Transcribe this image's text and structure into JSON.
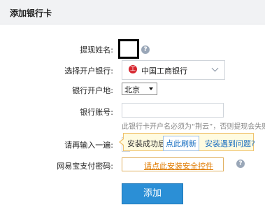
{
  "header": {
    "title": "添加银行卡"
  },
  "form": {
    "name_label": "提现姓名:",
    "name_help_icon": "question-circle-icon",
    "bank_label": "选择开户银行:",
    "bank_selected": "中国工商银行",
    "bank_logo_icon": "icbc-logo-icon",
    "city_label": "银行开户地:",
    "city_selected": "北京",
    "account_label": "银行账号:",
    "account_hint": "此银行卡开户名必须为“荆云”，否则提现会失败。",
    "confirm_label": "请再输入一遍:",
    "tooltip": {
      "text": "安装成功后",
      "refresh_link": "点此刷新",
      "problem_link": "安装遇到问题?"
    },
    "password_label": "网易宝支付密码:",
    "install_link": "请点此安装安全控件",
    "password_help_icon": "question-circle-icon",
    "submit_label": "添加"
  },
  "colors": {
    "header_bg": "#f1f2f4",
    "button_bg": "#2b8fd6",
    "link_blue": "#1a6fc1",
    "link_orange": "#e07b00",
    "tooltip_bg": "#fffbe0",
    "bank_red": "#d7262f"
  }
}
